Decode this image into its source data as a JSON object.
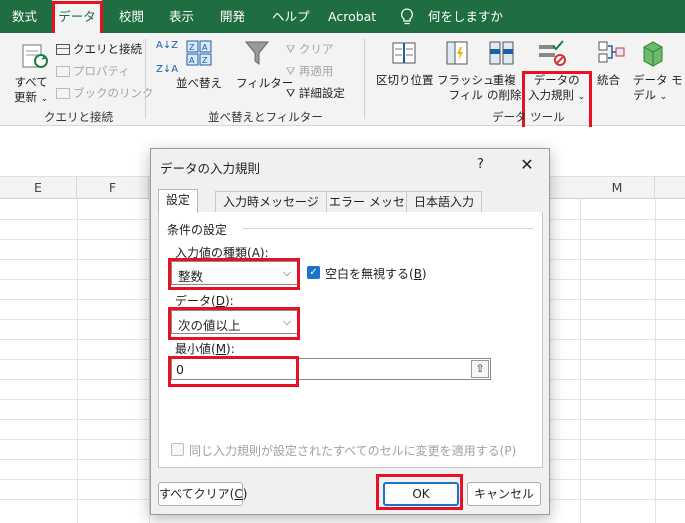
{
  "menu": {
    "tabs": [
      "数式",
      "データ",
      "校閲",
      "表示",
      "開発",
      "ヘルプ",
      "Acrobat"
    ],
    "active_tab": "データ",
    "tell_me": "何をしますか"
  },
  "ribbon": {
    "queries": {
      "refresh_all_line1": "すべて",
      "refresh_all_line2": "更新",
      "queries_connections": "クエリと接続",
      "properties": "プロパティ",
      "edit_links": "ブックのリンク",
      "group_label": "クエリと接続"
    },
    "sort_filter": {
      "sort_az": "A↓Z",
      "sort_za": "Z↓A",
      "sort": "並べ替え",
      "filter": "フィルター",
      "clear": "クリア",
      "reapply": "再適用",
      "advanced": "詳細設定",
      "group_label": "並べ替えとフィルター"
    },
    "data_tools": {
      "text_to_columns": "区切り位置",
      "flash_fill_line1": "フラッシュ",
      "flash_fill_line2": "フィル",
      "remove_dup_line1": "重複",
      "remove_dup_line2": "の削除",
      "validation_line1": "データの",
      "validation_line2": "入力規則",
      "consolidate": "統合",
      "data_model_line1": "データ モ",
      "data_model_line2": "デル",
      "group_label": "データ ツール"
    }
  },
  "sheet": {
    "columns": [
      "E",
      "F",
      "M"
    ]
  },
  "dialog": {
    "title": "データの入力規則",
    "help": "?",
    "close": "✕",
    "tabs": [
      "設定",
      "入力時メッセージ",
      "エラー メッセージ",
      "日本語入力"
    ],
    "active_tab": "設定",
    "section_label": "条件の設定",
    "allow_label": "入力値の種類(",
    "allow_key": "A",
    "allow_tail": "):",
    "allow_value": "整数",
    "ignore_blank_label": "空白を無視する(",
    "ignore_blank_key": "B",
    "ignore_blank_tail": ")",
    "ignore_blank_checked": true,
    "data_label": "データ(",
    "data_key": "D",
    "data_tail": "):",
    "data_value": "次の値以上",
    "min_label": "最小値(",
    "min_key": "M",
    "min_tail": "):",
    "min_value": "0",
    "apply_all_label": "同じ入力規則が設定されたすべてのセルに変更を適用する(P)",
    "clear_all_label": "すべてクリア(",
    "clear_all_key": "C",
    "clear_all_tail": ")",
    "ok_label": "OK",
    "cancel_label": "キャンセル"
  },
  "colors": {
    "excel_green": "#1e6e42",
    "highlight_red": "#e81123",
    "check_blue": "#1a73c9"
  }
}
